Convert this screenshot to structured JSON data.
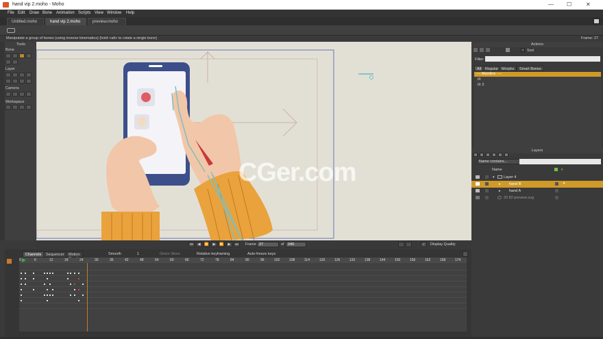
{
  "window": {
    "title": "hand vip 2.moho - Moho",
    "controls": [
      "—",
      "☐",
      "✕"
    ]
  },
  "menu": [
    "File",
    "Edit",
    "Draw",
    "Bone",
    "Animation",
    "Scripts",
    "View",
    "Window",
    "Help"
  ],
  "doc_tabs": [
    {
      "label": "Untitled.moho",
      "active": false
    },
    {
      "label": "hand vip 2.moho",
      "active": true
    },
    {
      "label": "preview.moho",
      "active": false
    }
  ],
  "status": {
    "hint": "Manipulate a group of bones (using inverse kinematics) (hold <alt> to rotate a single bone)",
    "frame": "Frame: 27"
  },
  "tools": {
    "header": "Tools",
    "sections": [
      "Bone",
      "Layer",
      "Camera",
      "Workspace"
    ]
  },
  "playback": {
    "frame_label": "Frame",
    "frame_value": "27",
    "of_label": "of",
    "total_frames": "240",
    "display_quality": "Display Quality"
  },
  "timeline": {
    "tabs": [
      "Channels",
      "Sequencer",
      "Motion Graph"
    ],
    "options": {
      "interp": "Smooth",
      "step": "1",
      "onion": "Onion Skins",
      "relative": "Relative keyframing",
      "autofreeze": "Auto-freeze keys"
    },
    "ruler": [
      "0",
      "6",
      "12",
      "18",
      "24",
      "30",
      "36",
      "42",
      "48",
      "54",
      "60",
      "66",
      "72",
      "78",
      "84",
      "90",
      "96",
      "102",
      "108",
      "114",
      "120",
      "126",
      "132",
      "138",
      "144",
      "150",
      "156",
      "162",
      "168",
      "174"
    ]
  },
  "actions": {
    "header": "Actions",
    "sort": "Sort",
    "filter_label": "Filter:",
    "filter_value": "",
    "tabs": [
      "All",
      "Regular",
      "Morphs",
      "Smart Bones"
    ],
    "items": [
      {
        "label": "---- Mainline ----",
        "selected": true
      },
      {
        "label": "I/r",
        "selected": false
      },
      {
        "label": "I/r 2",
        "selected": false
      }
    ]
  },
  "layers": {
    "header": "Layers",
    "filter_mode": "Name contains...",
    "filter_value": "",
    "column_name": "Name",
    "rows": [
      {
        "label": "Layer 4",
        "selected": false,
        "indent": 0
      },
      {
        "label": "hand B",
        "selected": true,
        "indent": 1
      },
      {
        "label": "hand A",
        "selected": false,
        "indent": 1
      },
      {
        "label": "20 82 preview.svg",
        "selected": false,
        "indent": 0
      }
    ]
  },
  "canvas": {
    "watermark": "CGer.com",
    "colors": {
      "bg": "#e2e0d5",
      "phone": "#3c4f8a",
      "sleeve": "#e9a23c",
      "skin": "#f2c6a8",
      "bone": "#7fbfc0"
    }
  },
  "accent": "#d09a28"
}
